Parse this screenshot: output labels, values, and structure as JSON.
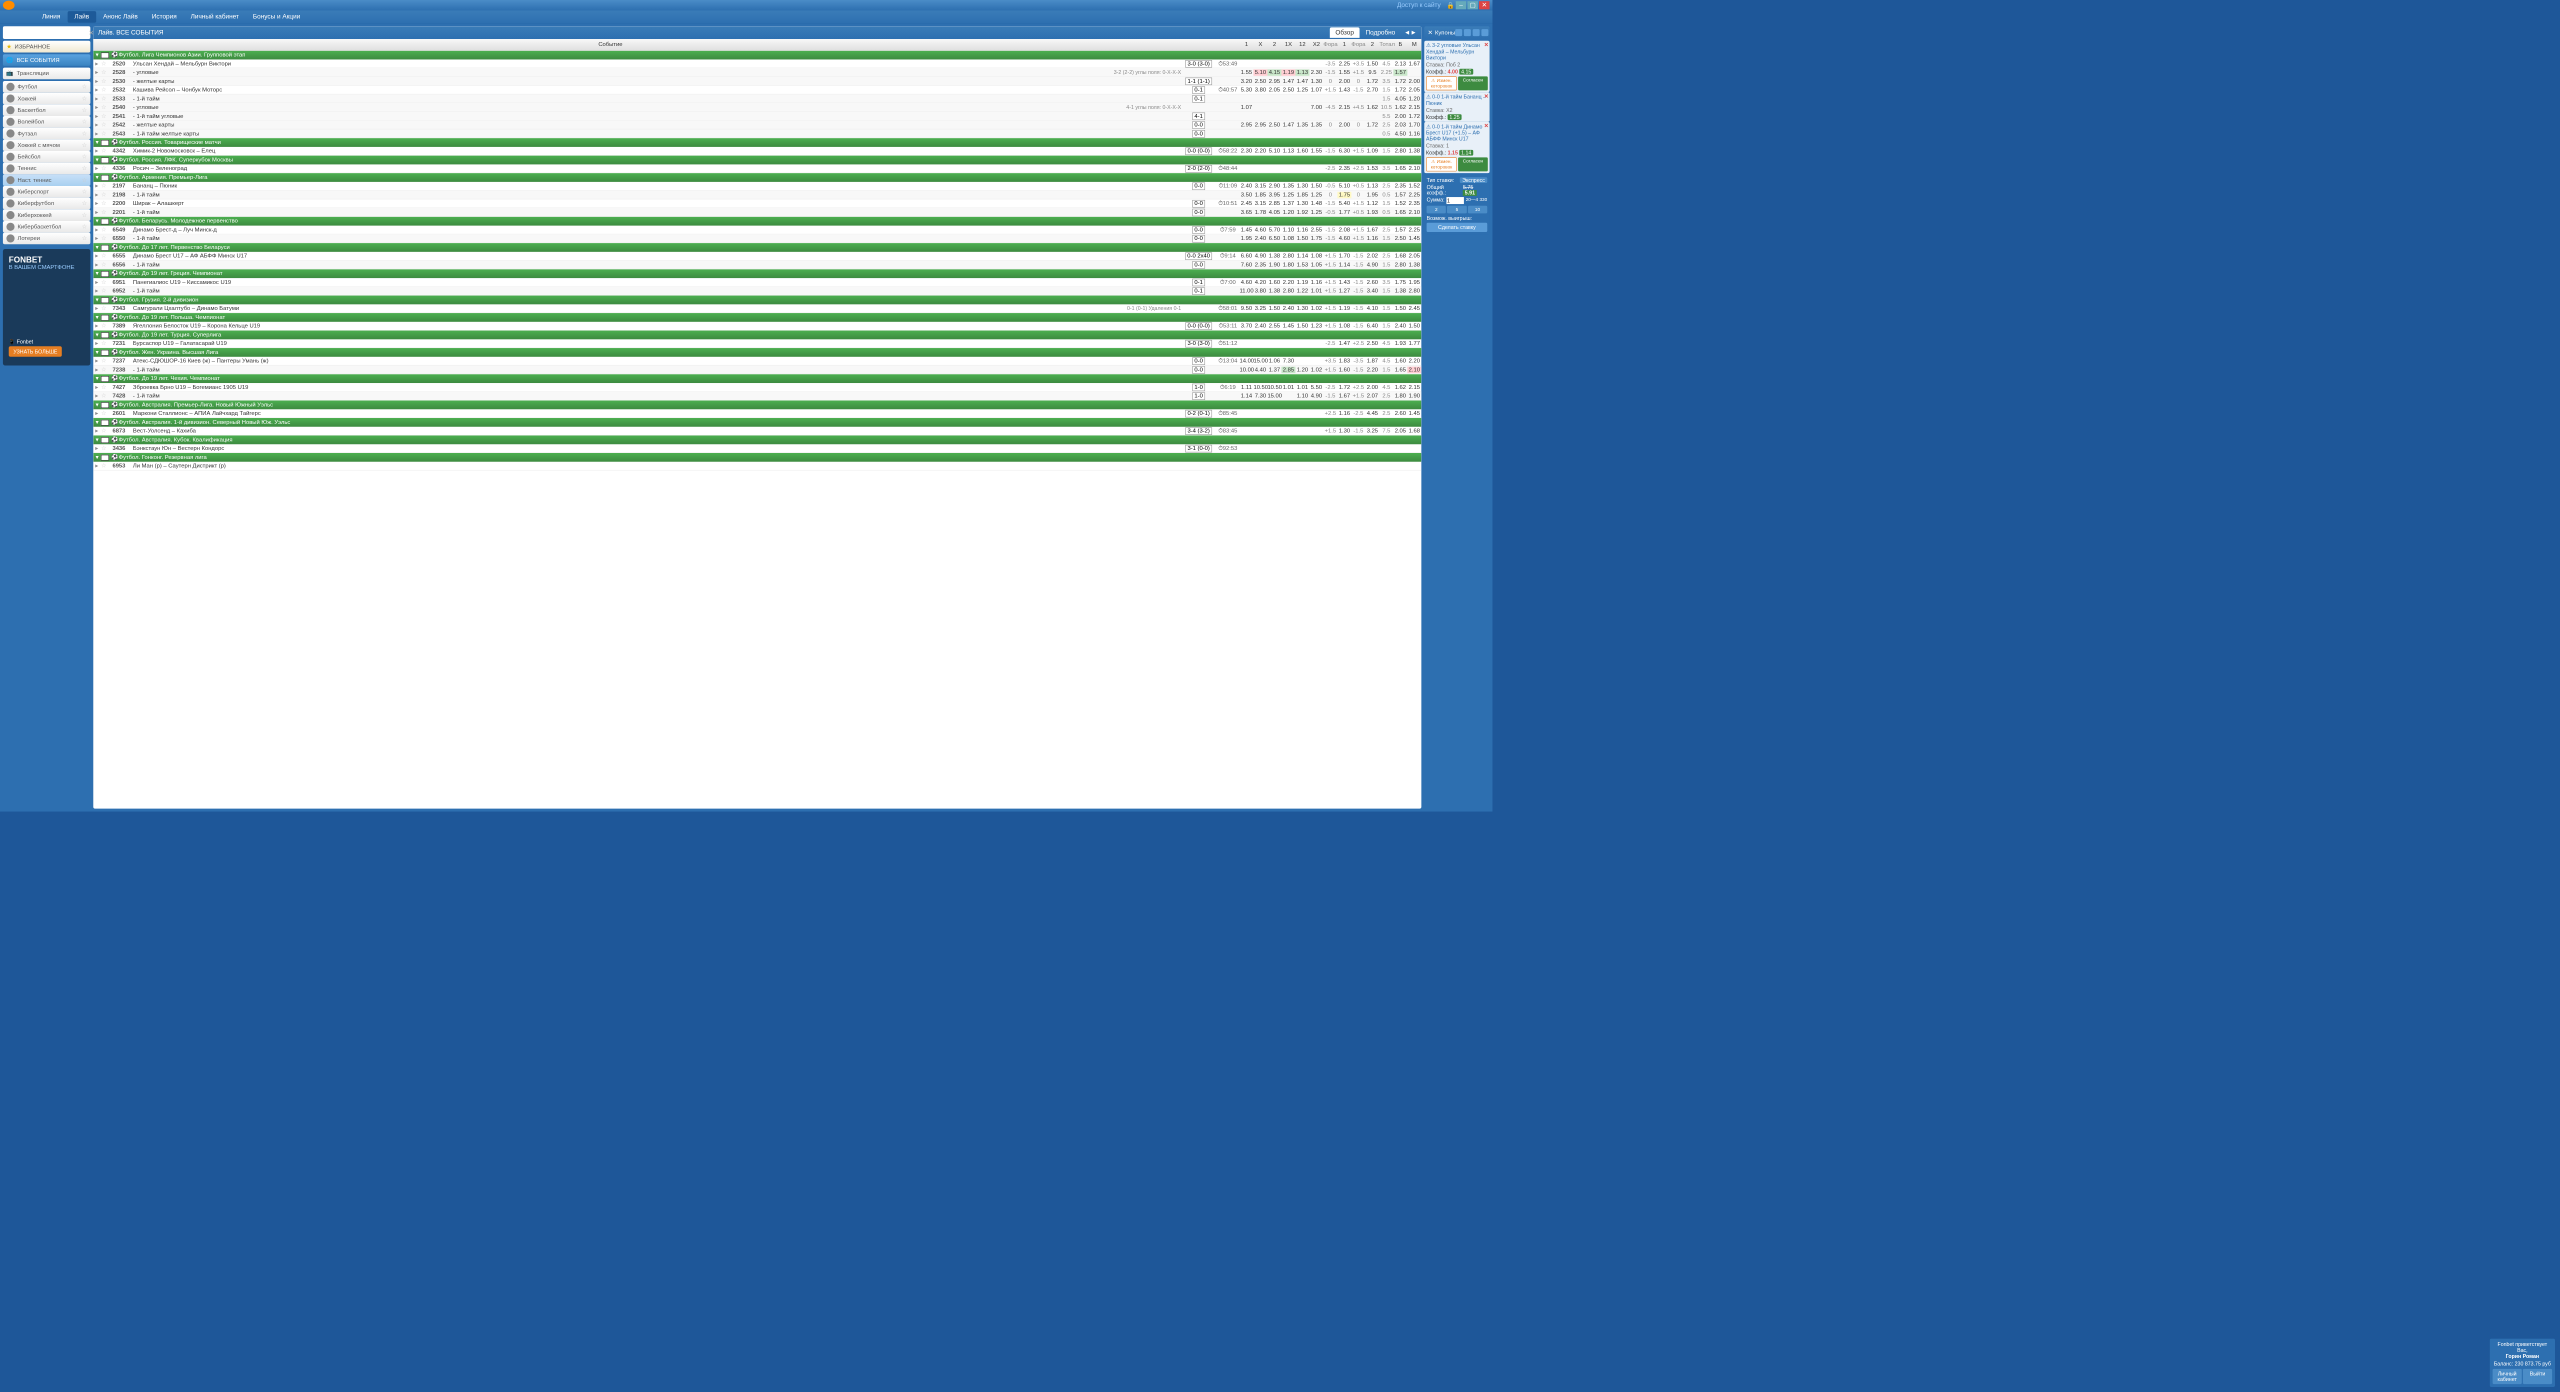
{
  "titlebar": {
    "access": "Доступ к сайту"
  },
  "menu": [
    "Линия",
    "Лайв",
    "Анонс Лайв",
    "История",
    "Личный кабинет",
    "Бонусы и Акции"
  ],
  "menu_active": 1,
  "sidebar": {
    "favorites": "ИЗБРАННОЕ",
    "all": "ВСЕ СОБЫТИЯ",
    "broadcasts": "Трансляции",
    "sports": [
      "Футбол",
      "Хоккей",
      "Баскетбол",
      "Волейбол",
      "Футзал",
      "Хоккей с мячом",
      "Бейсбол",
      "Теннис",
      "Наст. теннис",
      "Киберспорт",
      "Киберфутбол",
      "Киберхоккей",
      "Кибербаскетбол",
      "Лотереи"
    ],
    "selected_sport": 8
  },
  "promo": {
    "title": "FONBET",
    "sub": "В ВАШЕМ СМАРТФОНЕ",
    "footer": "Fonbet",
    "btn": "УЗНАТЬ БОЛЬШЕ"
  },
  "main": {
    "title": "Лайв. ВСЕ СОБЫТИЯ",
    "tabs": [
      "Обзор",
      "Подробно"
    ],
    "active_tab": 0,
    "event_col": "Событие",
    "cols": [
      "1",
      "X",
      "2",
      "1X",
      "12",
      "X2",
      "Фора",
      "1",
      "Фора",
      "2",
      "Тотал",
      "Б",
      "М"
    ]
  },
  "events": [
    {
      "t": "g",
      "flag": "",
      "name": "Футбол. Лига Чемпионов Азии. Групповой этап"
    },
    {
      "t": "e",
      "id": "2520",
      "name": "Ульсан Хендай – Мельбурн Виктори",
      "info": "",
      "score": "3-0 (3-0)",
      "time": "53:49",
      "o": [
        "",
        "",
        "",
        "",
        "",
        "",
        "-3.5",
        "2.25",
        "+3.5",
        "1.50",
        "4.5",
        "2.13",
        "1.67"
      ],
      "hl": {}
    },
    {
      "t": "e",
      "id": "2528",
      "name": "- угловые",
      "sub": true,
      "info": "3-2 (2-2) углы поля: 0-X-X-X",
      "score": "",
      "time": "",
      "o": [
        "1.55",
        "5.10",
        "4.15",
        "1.19",
        "1.13",
        "2.30",
        "-1.5",
        "1.55",
        "+1.5",
        "9.5",
        "2.25",
        "1.57",
        ""
      ],
      "hl": {
        "1": "r",
        "2": "g",
        "3": "r",
        "4": "g",
        "11": "g",
        "12": "r"
      }
    },
    {
      "t": "e",
      "id": "2530",
      "name": "- желтые карты",
      "sub": true,
      "score": "1-1 (1-1)",
      "time": "",
      "o": [
        "3.20",
        "2.50",
        "2.95",
        "1.47",
        "1.47",
        "1.30",
        "0",
        "2.00",
        "0",
        "1.72",
        "3.5",
        "1.72",
        "2.00"
      ]
    },
    {
      "t": "e",
      "id": "2532",
      "name": "Кашива Рейсол – Чонбук Моторс",
      "score": "0-1",
      "time": "40:57",
      "o": [
        "5.30",
        "3.80",
        "2.05",
        "2.50",
        "1.25",
        "1.07",
        "+1.5",
        "1.43",
        "-1.5",
        "2.70",
        "1.5",
        "1.72",
        "2.05"
      ]
    },
    {
      "t": "e",
      "id": "2533",
      "name": "- 1-й тайм",
      "sub": true,
      "score": "0-1",
      "time": "",
      "o": [
        "",
        "",
        "",
        "",
        "",
        "",
        "",
        "",
        "",
        "",
        "1.5",
        "4.05",
        "1.20"
      ]
    },
    {
      "t": "e",
      "id": "2540",
      "name": "- угловые",
      "sub": true,
      "info": "4-1 углы поля: 0-X-X-X",
      "score": "",
      "time": "",
      "o": [
        "1.07",
        "",
        "",
        "",
        "",
        "7.00",
        "-4.5",
        "2.15",
        "+4.5",
        "1.62",
        "10.5",
        "1.62",
        "2.15"
      ]
    },
    {
      "t": "e",
      "id": "2541",
      "name": "- 1-й тайм угловые",
      "sub": true,
      "score": "4-1",
      "time": "",
      "o": [
        "",
        "",
        "",
        "",
        "",
        "",
        "",
        "",
        "",
        "",
        "5.5",
        "2.00",
        "1.72"
      ]
    },
    {
      "t": "e",
      "id": "2542",
      "name": "- желтые карты",
      "sub": true,
      "score": "0-0",
      "time": "",
      "o": [
        "2.95",
        "2.95",
        "2.50",
        "1.47",
        "1.35",
        "1.35",
        "0",
        "2.00",
        "0",
        "1.72",
        "2.5",
        "2.03",
        "1.70"
      ]
    },
    {
      "t": "e",
      "id": "2543",
      "name": "- 1-й тайм желтые карты",
      "sub": true,
      "score": "0-0",
      "time": "",
      "o": [
        "",
        "",
        "",
        "",
        "",
        "",
        "",
        "",
        "",
        "",
        "0.5",
        "4.50",
        "1.16"
      ]
    },
    {
      "t": "g",
      "flag": "ru",
      "name": "Футбол. Россия. Товарищеские матчи"
    },
    {
      "t": "e",
      "id": "4342",
      "name": "Химик-2 Новомосковск – Елец",
      "score": "0-0 (0-0)",
      "time": "58:22",
      "o": [
        "2.30",
        "2.20",
        "5.10",
        "1.13",
        "1.60",
        "1.55",
        "-1.5",
        "6.30",
        "+1.5",
        "1.09",
        "1.5",
        "2.80",
        "1.38"
      ]
    },
    {
      "t": "g",
      "flag": "ru",
      "name": "Футбол. Россия. ЛФК. Суперкубок Москвы"
    },
    {
      "t": "e",
      "id": "4336",
      "name": "Росич – Зеленоград",
      "score": "2-0 (2-0)",
      "time": "48:44",
      "o": [
        "",
        "",
        "",
        "",
        "",
        "",
        "-2.5",
        "2.35",
        "+2.5",
        "1.53",
        "3.5",
        "1.65",
        "2.10"
      ]
    },
    {
      "t": "g",
      "flag": "am",
      "name": "Футбол. Армения. Премьер-Лига"
    },
    {
      "t": "e",
      "id": "2197",
      "name": "Бананц – Пюник",
      "score": "0-0",
      "time": "11:09",
      "o": [
        "2.40",
        "3.15",
        "2.90",
        "1.35",
        "1.30",
        "1.50",
        "-0.5",
        "5.10",
        "+0.5",
        "1.13",
        "2.5",
        "2.35",
        "1.52"
      ]
    },
    {
      "t": "e",
      "id": "2198",
      "name": "- 1-й тайм",
      "sub": true,
      "score": "",
      "time": "",
      "o": [
        "3.50",
        "1.85",
        "3.95",
        "1.25",
        "1.85",
        "1.25",
        "0",
        "1.75",
        "0",
        "1.95",
        "0.5",
        "1.57",
        "2.25"
      ],
      "hl": {
        "7": "y"
      }
    },
    {
      "t": "e",
      "id": "2200",
      "name": "Ширак – Алашкерт",
      "score": "0-0",
      "time": "10:51",
      "o": [
        "2.45",
        "3.15",
        "2.85",
        "1.37",
        "1.30",
        "1.48",
        "-1.5",
        "5.40",
        "+1.5",
        "1.12",
        "1.5",
        "1.52",
        "2.35"
      ]
    },
    {
      "t": "e",
      "id": "2201",
      "name": "- 1-й тайм",
      "sub": true,
      "score": "0-0",
      "time": "",
      "o": [
        "3.65",
        "1.78",
        "4.05",
        "1.20",
        "1.92",
        "1.25",
        "-0.5",
        "1.77",
        "+0.5",
        "1.93",
        "0.5",
        "1.65",
        "2.10"
      ]
    },
    {
      "t": "g",
      "flag": "by",
      "name": "Футбол. Беларусь. Молодежное первенство"
    },
    {
      "t": "e",
      "id": "6549",
      "name": "Динамо Брест-д – Луч Минск-д",
      "score": "0-0",
      "time": "7:59",
      "o": [
        "1.45",
        "4.60",
        "5.70",
        "1.10",
        "1.16",
        "2.55",
        "-1.5",
        "2.08",
        "+1.5",
        "1.67",
        "2.5",
        "1.57",
        "2.25"
      ]
    },
    {
      "t": "e",
      "id": "6550",
      "name": "- 1-й тайм",
      "sub": true,
      "score": "0-0",
      "time": "",
      "o": [
        "1.95",
        "2.40",
        "6.50",
        "1.08",
        "1.50",
        "1.75",
        "-1.5",
        "4.60",
        "+1.5",
        "1.16",
        "1.5",
        "2.50",
        "1.45"
      ]
    },
    {
      "t": "g",
      "flag": "by",
      "name": "Футбол. До 17 лет. Первенство Беларуси"
    },
    {
      "t": "e",
      "id": "6555",
      "name": "Динамо Брест U17 – АФ АБФФ Минск U17",
      "score": "0-0 2x40",
      "time": "9:14",
      "o": [
        "6.60",
        "4.90",
        "1.38",
        "2.80",
        "1.14",
        "1.08",
        "+1.5",
        "1.70",
        "-1.5",
        "2.02",
        "2.5",
        "1.68",
        "2.05"
      ],
      "hl": {
        "8": "y"
      }
    },
    {
      "t": "e",
      "id": "6556",
      "name": "- 1-й тайм",
      "sub": true,
      "score": "0-0",
      "time": "",
      "o": [
        "7.60",
        "2.35",
        "1.90",
        "1.80",
        "1.53",
        "1.05",
        "+1.5",
        "1.14",
        "-1.5",
        "4.90",
        "1.5",
        "2.80",
        "1.38"
      ],
      "hl": {
        "8": "y"
      }
    },
    {
      "t": "g",
      "flag": "gr",
      "name": "Футбол. До 19 лет. Греция. Чемпионат"
    },
    {
      "t": "e",
      "id": "6951",
      "name": "Панегиалиос U19 – Киссамикос U19",
      "score": "0-1",
      "time": "7:00",
      "o": [
        "4.60",
        "4.20",
        "1.60",
        "2.20",
        "1.19",
        "1.16",
        "+1.5",
        "1.43",
        "-1.5",
        "2.60",
        "3.5",
        "1.75",
        "1.95"
      ]
    },
    {
      "t": "e",
      "id": "6952",
      "name": "- 1-й тайм",
      "sub": true,
      "score": "0-1",
      "time": "",
      "o": [
        "11.00",
        "3.80",
        "1.38",
        "2.80",
        "1.22",
        "1.01",
        "+1.5",
        "1.27",
        "-1.5",
        "3.40",
        "1.5",
        "1.38",
        "2.80"
      ]
    },
    {
      "t": "g",
      "flag": "ge",
      "name": "Футбол. Грузия. 2-й дивизион"
    },
    {
      "t": "e",
      "id": "7343",
      "name": "Самгурали Цхалтубо – Динамо Батуми",
      "info": "0-1 (0-1) Удаления 0-1",
      "score": "",
      "time": "58:01",
      "o": [
        "9.50",
        "3.25",
        "1.50",
        "2.40",
        "1.30",
        "1.02",
        "+1.5",
        "1.19",
        "-1.5",
        "4.10",
        "1.5",
        "1.50",
        "2.45"
      ]
    },
    {
      "t": "g",
      "flag": "pl",
      "name": "Футбол. До 19 лет. Польша. Чемпионат"
    },
    {
      "t": "e",
      "id": "7389",
      "name": "Ягеллония Белосток U19 – Корона Кельце U19",
      "score": "0-0 (0-0)",
      "time": "53:11",
      "o": [
        "3.70",
        "2.40",
        "2.55",
        "1.45",
        "1.50",
        "1.23",
        "+1.5",
        "1.08",
        "-1.5",
        "6.40",
        "1.5",
        "2.40",
        "1.50"
      ]
    },
    {
      "t": "g",
      "flag": "tr",
      "name": "Футбол. До 19 лет. Турция. Суперлига"
    },
    {
      "t": "e",
      "id": "7231",
      "name": "Бурсаспор U19 – Галатасарай U19",
      "score": "3-0 (3-0)",
      "time": "51:12",
      "o": [
        "",
        "",
        "",
        "",
        "",
        "",
        "-2.5",
        "1.47",
        "+2.5",
        "2.50",
        "4.5",
        "1.93",
        "1.77"
      ]
    },
    {
      "t": "g",
      "flag": "ua",
      "name": "Футбол. Жен. Украина. Высшая Лига"
    },
    {
      "t": "e",
      "id": "7237",
      "name": "Атекс-СДЮШОР-16 Киев (ж) – Пантеры Умань (ж)",
      "score": "0-0",
      "time": "13:04",
      "o": [
        "14.00",
        "15.00",
        "1.06",
        "7.30",
        "",
        "",
        "+3.5",
        "1.83",
        "-3.5",
        "1.87",
        "4.5",
        "1.60",
        "2.20"
      ]
    },
    {
      "t": "e",
      "id": "7238",
      "name": "- 1-й тайм",
      "sub": true,
      "score": "0-0",
      "time": "",
      "o": [
        "10.00",
        "4.40",
        "1.37",
        "2.85",
        "1.20",
        "1.02",
        "+1.5",
        "1.60",
        "-1.5",
        "2.20",
        "1.5",
        "1.65",
        "2.10"
      ],
      "hl": {
        "3": "g",
        "12": "r"
      }
    },
    {
      "t": "g",
      "flag": "cz",
      "name": "Футбол. До 19 лет. Чехия. Чемпионат"
    },
    {
      "t": "e",
      "id": "7427",
      "name": "Зброевка Брно U19 – Богемианс 1905 U19",
      "score": "1-0",
      "time": "6:19",
      "o": [
        "1.11",
        "10.50",
        "10.50",
        "1.01",
        "1.01",
        "5.50",
        "-2.5",
        "1.72",
        "+2.5",
        "2.00",
        "4.5",
        "1.62",
        "2.15"
      ]
    },
    {
      "t": "e",
      "id": "7428",
      "name": "- 1-й тайм",
      "sub": true,
      "score": "1-0",
      "time": "",
      "o": [
        "1.14",
        "7.30",
        "15.00",
        "",
        "1.10",
        "4.90",
        "-1.5",
        "1.67",
        "+1.5",
        "2.07",
        "2.5",
        "1.80",
        "1.90"
      ]
    },
    {
      "t": "g",
      "flag": "au",
      "name": "Футбол. Австралия. Премьер-Лига. Новый Южный Уэльс"
    },
    {
      "t": "e",
      "id": "2601",
      "name": "Маркони Сталлионс – АПИА Лайчхард Тайгерс",
      "score": "0-2 (0-1)",
      "time": "85:45",
      "o": [
        "",
        "",
        "",
        "",
        "",
        "",
        "+2.5",
        "1.16",
        "-2.5",
        "4.45",
        "2.5",
        "2.60",
        "1.45"
      ]
    },
    {
      "t": "g",
      "flag": "au",
      "name": "Футбол. Австралия. 1-й дивизион. Северный Новый Юж. Уэльс"
    },
    {
      "t": "e",
      "id": "6873",
      "name": "Вест-Уолсенд – Кахиба",
      "score": "3-4 (3-2)",
      "time": "83:45",
      "o": [
        "",
        "",
        "",
        "",
        "",
        "",
        "+1.5",
        "1.30",
        "-1.5",
        "3.25",
        "7.5",
        "2.05",
        "1.68"
      ]
    },
    {
      "t": "g",
      "flag": "au",
      "name": "Футбол. Австралия. Кубок. Квалификация"
    },
    {
      "t": "e",
      "id": "3436",
      "name": "Бэнкстаун Юн – Вестерн Кондорс",
      "score": "3-1 (0-0)",
      "time": "92:53",
      "o": [
        "",
        "",
        "",
        "",
        "",
        "",
        "",
        "",
        "",
        "",
        "",
        "",
        ""
      ]
    },
    {
      "t": "g",
      "flag": "hk",
      "name": "Футбол. Гонконг. Резервная лига"
    },
    {
      "t": "e",
      "id": "6953",
      "name": "Ли Ман (р) – Саутерн Дистрикт (р)",
      "score": "",
      "time": "",
      "o": [
        "",
        "",
        "",
        "",
        "",
        "",
        "",
        "",
        "",
        "",
        "",
        "",
        ""
      ]
    }
  ],
  "coupon": {
    "title": "Купоны",
    "bets": [
      {
        "name": "3-2 угловые Ульсан Хендай – Мельбурн Виктори",
        "line": "Ставка: Поб 2",
        "old": "4.00",
        "new": "4.15"
      },
      {
        "name": "0-0 1-й тайм Бананц – Пюник",
        "line": "Ставка: X2",
        "koef": "1.25"
      },
      {
        "name": "0-0 1-й тайм Динамо Брест U17 (+1.5) – АФ АБФФ Минск U17",
        "line": "Ставка: 1",
        "old": "1.15",
        "new": "1.14"
      }
    ],
    "btns": {
      "warn": "Измен. которовок",
      "ok": "Согласен"
    },
    "type_label": "Тип ставки:",
    "type": "Экспресс",
    "total_label": "Общий коэфф.:",
    "total_old": "5.75",
    "total_new": "5.91",
    "sum_label": "Сумма:",
    "sum": "1",
    "range": "20—4 330",
    "quick": [
      "2",
      "5",
      "10"
    ],
    "win_label": "Возмож. выигрыш:",
    "place": "Сделать ставку"
  },
  "user": {
    "greet": "Fonbet приветствует Вас,",
    "name": "Горин Роман",
    "bal_label": "Баланс:",
    "bal": "230 873.75 руб",
    "btn1": "Личный кабинет",
    "btn2": "Выйти"
  }
}
